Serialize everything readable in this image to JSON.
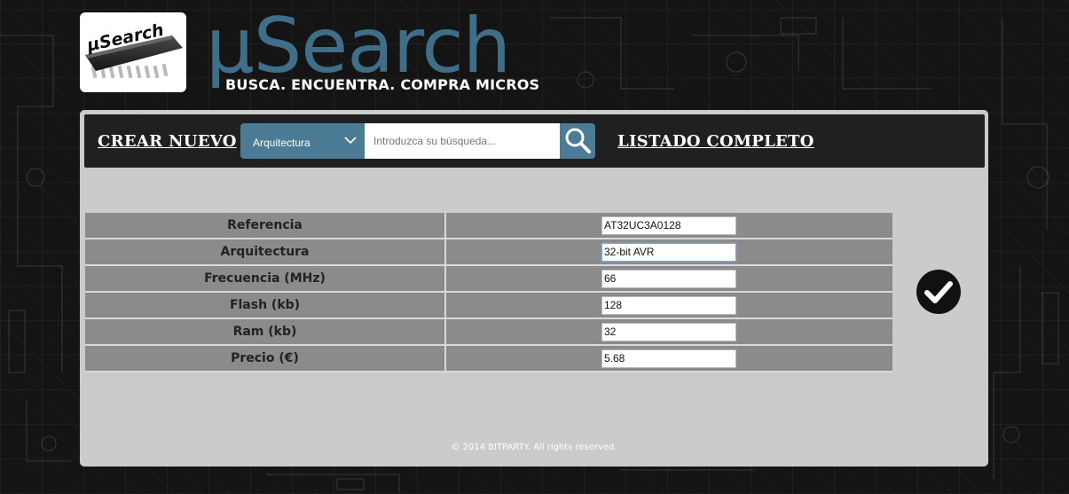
{
  "header": {
    "logo_text": "µSearch",
    "title": "µSearch",
    "tagline": "BUSCA. ENCUENTRA. COMPRA MICROS"
  },
  "nav": {
    "create_label": "CREAR NUEVO",
    "list_label": "LISTADO COMPLETO",
    "search": {
      "category_selected": "Arquitectura",
      "placeholder": "Introduzca su búsqueda...",
      "value": ""
    }
  },
  "form": {
    "fields": [
      {
        "label": "Referencia",
        "value": "AT32UC3A0128"
      },
      {
        "label": "Arquitectura",
        "value": "32-bit AVR"
      },
      {
        "label": "Frecuencia (MHz)",
        "value": "66"
      },
      {
        "label": "Flash (kb)",
        "value": "128"
      },
      {
        "label": "Ram (kb)",
        "value": "32"
      },
      {
        "label": "Precio (€)",
        "value": "5.68"
      }
    ]
  },
  "footer": {
    "text": "© 2014 BITPARTY. All rights reserved."
  },
  "colors": {
    "accent": "#4b7b95",
    "title": "#3f6e88",
    "panel": "#cbcbcb",
    "navbar": "#202020",
    "row": "#8b8b8b"
  },
  "icons": {
    "search": "magnifier-icon",
    "confirm": "checkmark-circle-icon",
    "dropdown": "chevron-down-icon",
    "logo": "microchip-logo"
  }
}
